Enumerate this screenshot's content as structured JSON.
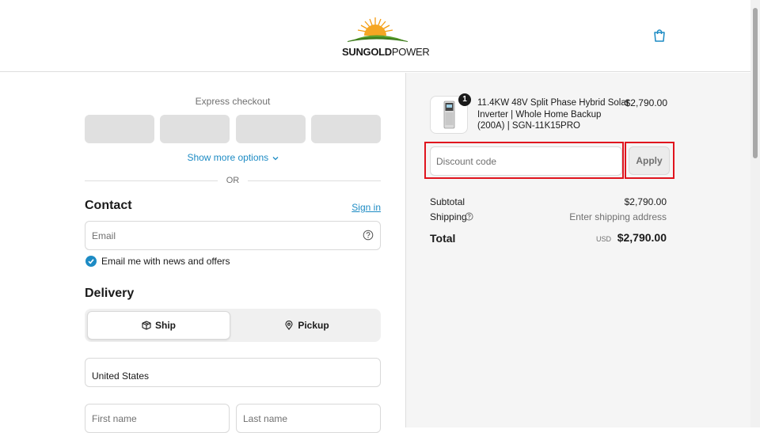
{
  "header": {
    "brand_bold": "SUNGOLD",
    "brand_light": "POWER",
    "cart_icon": "shopping-bag-icon"
  },
  "express": {
    "label": "Express checkout",
    "show_more": "Show more options",
    "or": "OR"
  },
  "contact": {
    "title": "Contact",
    "sign_in": "Sign in",
    "email_placeholder": "Email",
    "email_optin_label": "Email me with news and offers",
    "email_optin_checked": true
  },
  "delivery": {
    "title": "Delivery",
    "options": [
      {
        "label": "Ship",
        "icon": "box-icon",
        "selected": true
      },
      {
        "label": "Pickup",
        "icon": "location-pin-icon",
        "selected": false
      }
    ],
    "country_value": "United States",
    "first_name_placeholder": "First name",
    "last_name_placeholder": "Last name"
  },
  "order": {
    "item": {
      "name": "11.4KW 48V Split Phase Hybrid Solar Inverter | Whole Home Backup (200A) | SGN-11K15PRO",
      "price": "$2,790.00",
      "quantity": "1"
    },
    "discount_placeholder": "Discount code",
    "apply_label": "Apply",
    "subtotal_label": "Subtotal",
    "subtotal_value": "$2,790.00",
    "shipping_label": "Shipping",
    "shipping_value": "Enter shipping address",
    "total_label": "Total",
    "total_currency": "USD",
    "total_value": "$2,790.00"
  },
  "colors": {
    "accent": "#1d8bc4",
    "highlight": "#e0141e"
  }
}
